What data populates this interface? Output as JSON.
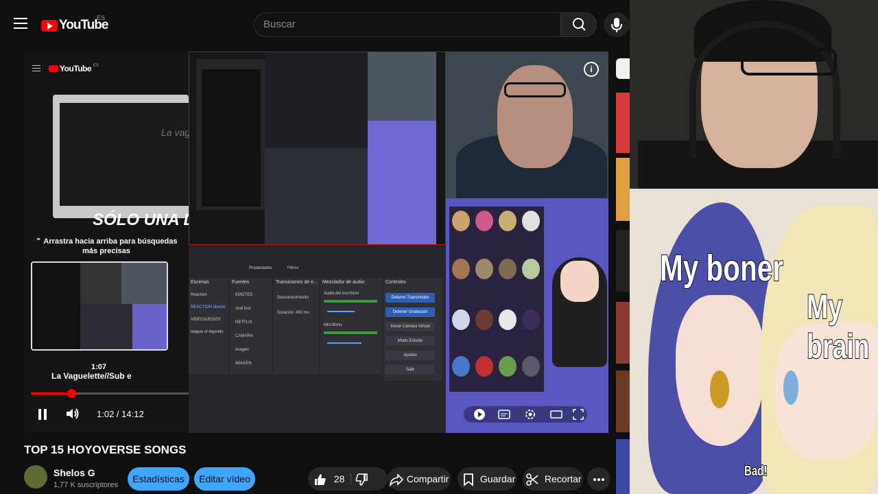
{
  "header": {
    "logo_text": "YouTube",
    "logo_region": "ES",
    "search_placeholder": "Buscar"
  },
  "player": {
    "embedded_logo": "YouTube",
    "embedded_region": "ES",
    "solo_text": "SÓLO UNA DE",
    "vague_text": "La vague",
    "drag_hint": "⌃ Arrastra hacia arriba para búsquedas más precisas",
    "preview_time": "1:07",
    "embedded_channel": "La Vaguelette//Sub e",
    "progress_fraction": 0.073,
    "time_display": "1:02 / 14:12",
    "obs": {
      "scene_header": "Escenas",
      "scenes": [
        "Reaction",
        "REACTION directo",
        "VIDEOJUEGOS",
        "league of legends"
      ],
      "sources_header": "Fuentes",
      "sources": [
        "EMOTES",
        "chat box",
        "NETFLIX",
        "CAMARA",
        "imagen",
        "IMAGEN"
      ],
      "transitions_header": "Transiciones de e...",
      "transition": "Desvanecimiento",
      "duration_label": "Duración",
      "duration_value": "450 ms",
      "mixer_header": "Mezclador de audio",
      "mixer_items": [
        "Audio del escritorio",
        "Micrófono"
      ],
      "controls_header": "Controles",
      "controls": [
        "Detener Transmisión",
        "Detener Grabación",
        "Iniciar Cámara Virtual",
        "Modo Estudio",
        "Ajustes",
        "Salir"
      ],
      "properties": "Propiedades",
      "filters": "Filtros"
    }
  },
  "video": {
    "title": "TOP 15 HOYOVERSE SONGS",
    "channel_name": "Shelos G",
    "subscribers": "1,77 K suscriptores",
    "stats_button": "Estadísticas",
    "edit_button": "Editar vídeo",
    "like_count": "28",
    "share_label": "Compartir",
    "save_label": "Guardar",
    "clip_label": "Recortar"
  },
  "meme": {
    "text_left": "My boner",
    "text_right": "My brain",
    "text_bottom": "Bad!"
  },
  "colors": {
    "background": "#0f0f0f",
    "youtube_red": "#ff0000",
    "accent_blue": "#3ea6ff",
    "chip_dark": "#272727"
  }
}
